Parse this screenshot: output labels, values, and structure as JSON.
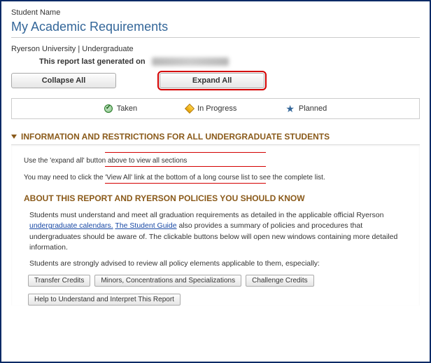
{
  "header": {
    "student_name_label": "Student Name",
    "page_title": "My Academic Requirements",
    "institution_line": "Ryerson University | Undergraduate",
    "report_generated_label": "This report last generated on"
  },
  "buttons": {
    "collapse_all": "Collapse All",
    "expand_all": "Expand All"
  },
  "legend": {
    "taken": "Taken",
    "in_progress": "In Progress",
    "planned": "Planned"
  },
  "section": {
    "title": "INFORMATION AND RESTRICTIONS FOR ALL UNDERGRADUATE STUDENTS",
    "note_expand": "Use the 'expand all' button above to view all sections",
    "note_viewall": "You may need to click the 'View All' link at the bottom of a long course list to see the complete list.",
    "about_heading": "ABOUT THIS REPORT AND RYERSON POLICIES YOU SHOULD KNOW",
    "para1_pre": "Students must understand and meet all graduation requirements as detailed in the applicable official Ryerson ",
    "link_calendars": "undergraduate calendars.",
    "para1_mid": " ",
    "link_student_guide": "The Student Guide",
    "para1_post": " also provides a summary of policies and procedures that undergraduates should be aware of. The clickable buttons below will open new windows containing more detailed information.",
    "para2": "Students are strongly advised to review all policy elements applicable to them, especially:",
    "btn_transfer": "Transfer Credits",
    "btn_minors": "Minors, Concentrations and Specializations",
    "btn_challenge": "Challenge Credits",
    "btn_help": "Help to Understand and Interpret This Report"
  }
}
